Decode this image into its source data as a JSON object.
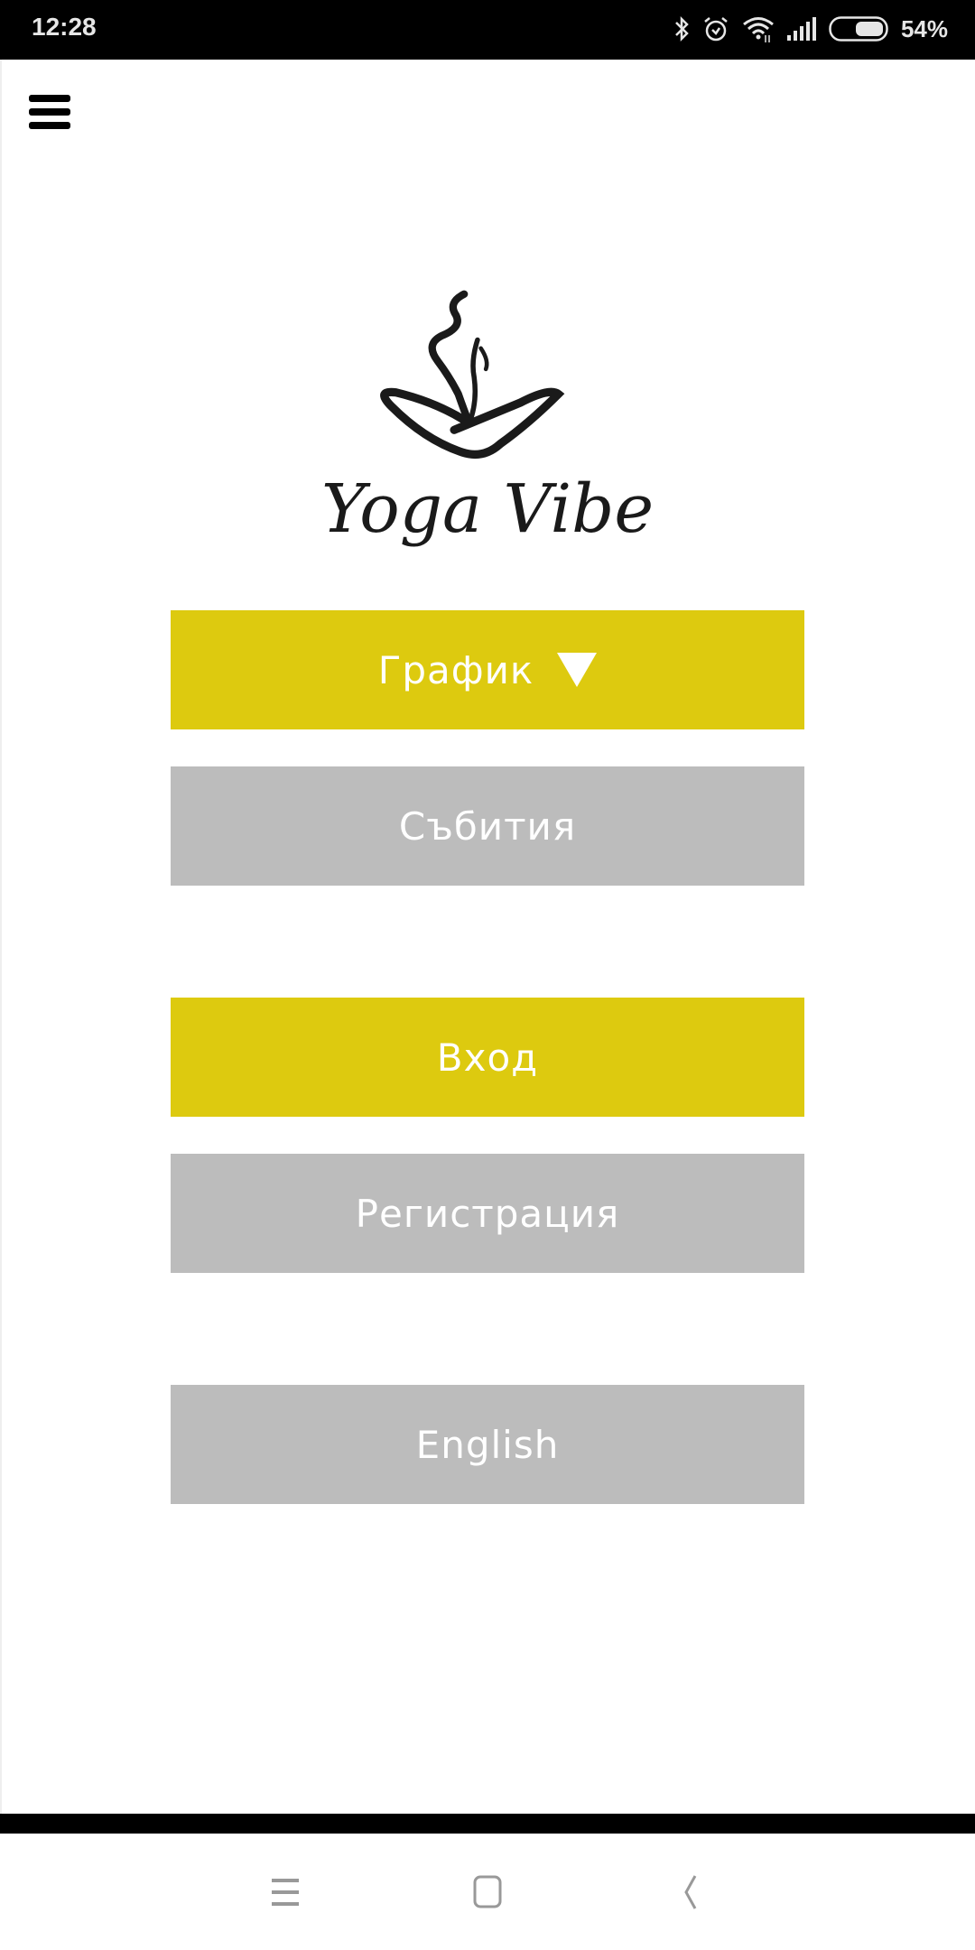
{
  "status_bar": {
    "time": "12:28",
    "icons": [
      "bluetooth-icon",
      "alarm-icon",
      "wifi-icon",
      "signal-icon",
      "battery-icon"
    ],
    "battery_percent": "54%"
  },
  "header": {
    "menu_icon": "hamburger-menu-icon"
  },
  "logo": {
    "text": "Yoga Vibe",
    "icon": "yoga-pose-logo"
  },
  "buttons": {
    "schedule": {
      "label": "График",
      "indicator": "dropdown-triangle"
    },
    "events": {
      "label": "Събития"
    },
    "login": {
      "label": "Вход"
    },
    "register": {
      "label": "Регистрация"
    },
    "language": {
      "label": "English"
    }
  },
  "colors": {
    "primary": "#ddca0f",
    "secondary": "#bcbcbc",
    "button_text": "#ffffff"
  },
  "nav_bar": {
    "items": [
      "recent-apps-icon",
      "home-icon",
      "back-icon"
    ]
  }
}
